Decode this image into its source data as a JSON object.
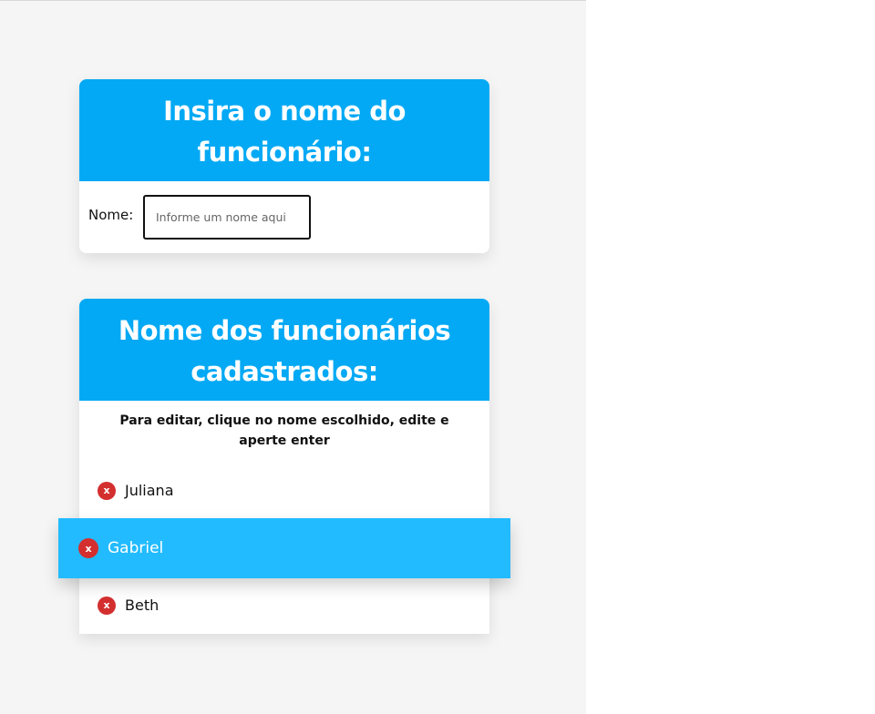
{
  "form_card": {
    "title": "Insira o nome do funcionário:",
    "name_label": "Nome:",
    "name_input_placeholder": "Informe um nome aqui",
    "name_input_value": ""
  },
  "list_card": {
    "title": "Nome dos funcionários cadastrados:",
    "hint": "Para editar, clique no nome escolhido, edite e aperte enter",
    "remove_label": "x",
    "employees": [
      {
        "name": "Juliana",
        "highlighted": false
      },
      {
        "name": "Gabriel",
        "highlighted": true
      },
      {
        "name": "Beth",
        "highlighted": false
      }
    ]
  },
  "colors": {
    "header": "#03a9f4",
    "highlight": "#22bbff",
    "remove_button": "#d32f2f",
    "page_background": "#f5f5f5"
  }
}
